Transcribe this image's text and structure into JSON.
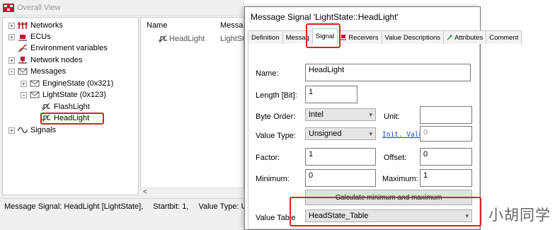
{
  "overall_view": {
    "title": "Overall View",
    "tree": [
      {
        "label": "Networks",
        "icon": "networks-icon",
        "expander": "+"
      },
      {
        "label": "ECUs",
        "icon": "ecu-icon",
        "expander": "+"
      },
      {
        "label": "Environment variables",
        "icon": "env-variable-icon",
        "expander": ""
      },
      {
        "label": "Network nodes",
        "icon": "network-node-icon",
        "expander": "+"
      },
      {
        "label": "Messages",
        "icon": "message-icon",
        "expander": "−"
      },
      {
        "label": "EngineState (0x321)",
        "icon": "message-icon",
        "expander": "+"
      },
      {
        "label": "LightState (0x123)",
        "icon": "message-icon",
        "expander": "−"
      },
      {
        "label": "FlashLight",
        "icon": "signal-icon",
        "expander": ""
      },
      {
        "label": "HeadLight",
        "icon": "signal-icon",
        "expander": ""
      },
      {
        "label": "Signals",
        "icon": "signals-icon",
        "expander": "+"
      }
    ],
    "list": {
      "columns": [
        "Name",
        "Messag"
      ],
      "rows": [
        {
          "name": "HeadLight",
          "message": "LightSt"
        }
      ]
    },
    "status": {
      "signal": "Message Signal: HeadLight [LightState],",
      "startbit": "Startbit: 1,",
      "value_type": "Value Type: U"
    }
  },
  "dialog": {
    "title": "Message Signal 'LightState::HeadLight'",
    "tabs": [
      "Definition",
      "Messag",
      "Signal",
      "Receivers",
      "Value Descriptions",
      "Attributes",
      "Comment"
    ],
    "active_tab": "Signal",
    "form": {
      "name_label": "Name:",
      "name_value": "HeadLight",
      "length_label": "Length [Bit]:",
      "length_value": "1",
      "byte_order_label": "Byte Order:",
      "byte_order_value": "Intel",
      "unit_label": "Unit:",
      "unit_value": "",
      "value_type_label": "Value Type:",
      "value_type_value": "Unsigned",
      "init_value_label": "Init. Valu",
      "init_value_value": "0",
      "factor_label": "Factor:",
      "factor_value": "1",
      "offset_label": "Offset:",
      "offset_value": "0",
      "minimum_label": "Minimum:",
      "minimum_value": "0",
      "maximum_label": "Maximum:",
      "maximum_value": "1",
      "calc_button": "Calculate minimum and maximum",
      "value_table_label": "Value Table",
      "value_table_value": "HeadState_Table"
    }
  },
  "watermark": "小胡同学",
  "colors": {
    "highlight": "#e0201c",
    "link": "#1a3fd0"
  }
}
